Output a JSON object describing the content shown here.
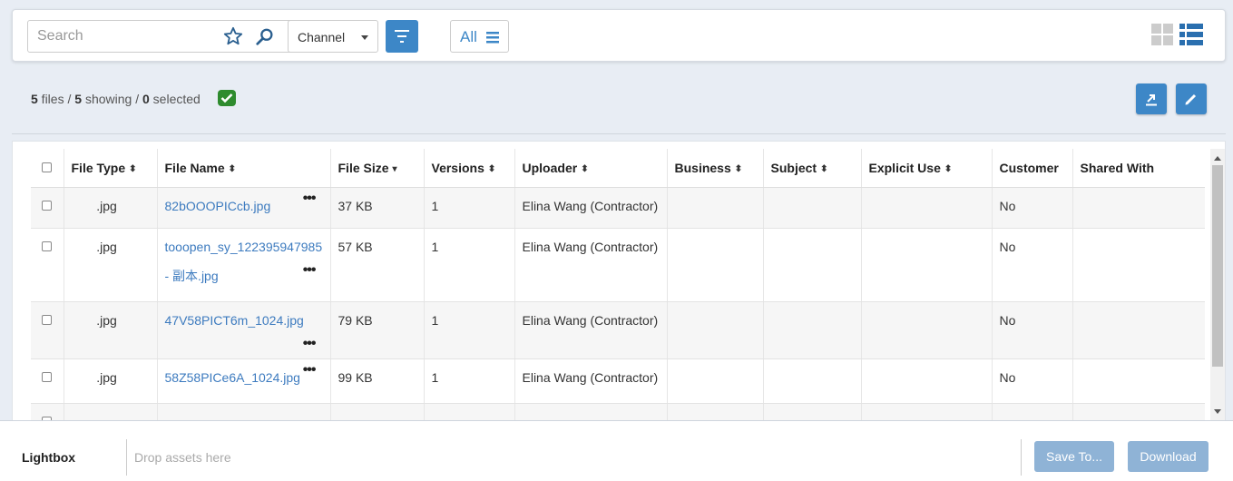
{
  "toolbar": {
    "search_placeholder": "Search",
    "channel_label": "Channel",
    "all_label": "All",
    "accent_color": "#3d87c7"
  },
  "status": {
    "files": "5",
    "files_label": " files / ",
    "showing": "5",
    "showing_label": " showing / ",
    "selected": "0",
    "selected_label": " selected"
  },
  "table": {
    "headers": [
      "File Type",
      "File Name",
      "File Size",
      "Versions",
      "Uploader",
      "Business",
      "Subject",
      "Explicit Use",
      "Customer",
      "Shared With"
    ],
    "rows": [
      {
        "type": ".jpg",
        "name": "82bOOOPICcb.jpg",
        "size": "37 KB",
        "versions": "1",
        "uploader": "Elina Wang (Contractor)",
        "business": "",
        "subject": "",
        "explicit": "",
        "customer": "No",
        "shared": ""
      },
      {
        "type": ".jpg",
        "name": "tooopen_sy_122395947985 - 副本.jpg",
        "size": "57 KB",
        "versions": "1",
        "uploader": "Elina Wang (Contractor)",
        "business": "",
        "subject": "",
        "explicit": "",
        "customer": "No",
        "shared": ""
      },
      {
        "type": ".jpg",
        "name": "47V58PICT6m_1024.jpg",
        "size": "79 KB",
        "versions": "1",
        "uploader": "Elina Wang (Contractor)",
        "business": "",
        "subject": "",
        "explicit": "",
        "customer": "No",
        "shared": ""
      },
      {
        "type": ".jpg",
        "name": "58Z58PICe6A_1024.jpg",
        "size": "99 KB",
        "versions": "1",
        "uploader": "Elina Wang (Contractor)",
        "business": "",
        "subject": "",
        "explicit": "",
        "customer": "No",
        "shared": ""
      }
    ]
  },
  "lightbox": {
    "title": "Lightbox",
    "drop_hint": "Drop assets here",
    "save_label": "Save To...",
    "download_label": "Download"
  }
}
